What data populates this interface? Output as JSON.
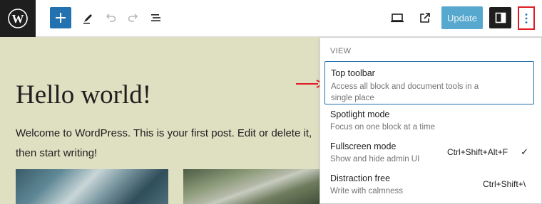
{
  "topbar": {
    "update_label": "Update"
  },
  "post": {
    "title": "Hello world!",
    "body": "Welcome to WordPress. This is your first post. Edit or delete it, then start writing!"
  },
  "menu": {
    "group_label": "VIEW",
    "items": [
      {
        "title": "Top toolbar",
        "desc": "Access all block and document tools in a single place",
        "shortcut": ""
      },
      {
        "title": "Spotlight mode",
        "desc": "Focus on one block at a time",
        "shortcut": ""
      },
      {
        "title": "Fullscreen mode",
        "desc": "Show and hide admin UI",
        "shortcut": "Ctrl+Shift+Alt+F",
        "checked_mark": "✓"
      },
      {
        "title": "Distraction free",
        "desc": "Write with calmness",
        "shortcut": "Ctrl+Shift+\\"
      }
    ]
  },
  "colors": {
    "accent": "#2271b1",
    "annotation": "#e01b24",
    "canvas_bg": "#dfdfc2"
  }
}
